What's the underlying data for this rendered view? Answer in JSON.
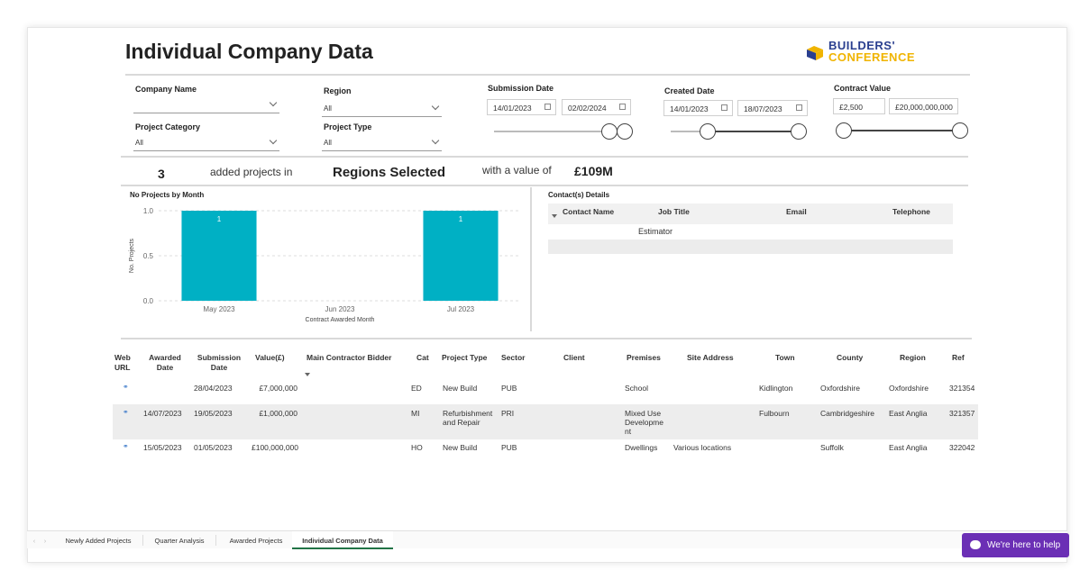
{
  "header": {
    "title": "Individual Company Data",
    "logo_line1": "BUILDERS'",
    "logo_line2": "CONFERENCE",
    "logo_icon": "builders-logo-icon",
    "brand_color": "#2a3f8f",
    "accent_color": "#f0b400"
  },
  "filters": {
    "company_name": {
      "label": "Company Name",
      "value": ""
    },
    "region": {
      "label": "Region",
      "value": "All"
    },
    "project_category": {
      "label": "Project Category",
      "value": "All"
    },
    "project_type": {
      "label": "Project Type",
      "value": "All"
    },
    "submission_date": {
      "label": "Submission Date",
      "from": "14/01/2023",
      "to": "02/02/2024"
    },
    "created_date": {
      "label": "Created Date",
      "from": "14/01/2023",
      "to": "18/07/2023"
    },
    "contract_value": {
      "label": "Contract Value",
      "from": "£2,500",
      "to": "£20,000,000,000"
    }
  },
  "kpi": {
    "count": "3",
    "added_text": "added projects in",
    "regions": "Regions Selected",
    "value_text": "with a value of",
    "value": "£109M"
  },
  "chart": {
    "title": "No Projects by Month"
  },
  "chart_data": {
    "type": "bar",
    "categories": [
      "May 2023",
      "Jun 2023",
      "Jul 2023"
    ],
    "values": [
      1,
      0,
      1
    ],
    "xlabel": "Contract Awarded Month",
    "ylabel": "No. Projects",
    "ylim": [
      0,
      1
    ],
    "yticks": [
      "0.0",
      "0.5",
      "1.0"
    ],
    "data_labels": [
      "1",
      "",
      "1"
    ],
    "bar_color": "#00b0c4"
  },
  "contacts": {
    "title": "Contact(s) Details",
    "headers": [
      "Contact Name",
      "Job Title",
      "Email",
      "Telephone"
    ],
    "rows": [
      [
        "",
        "Estimator",
        "",
        ""
      ]
    ]
  },
  "table": {
    "headers": [
      "Web URL",
      "Awarded Date",
      "Submission Date",
      "Value(£)",
      "Main Contractor Bidder",
      "Cat",
      "Project Type",
      "Sector",
      "Client",
      "Premises",
      "Site Address",
      "Town",
      "County",
      "Region",
      "Ref"
    ],
    "rows": [
      [
        "",
        "",
        "28/04/2023",
        "£7,000,000",
        "",
        "ED",
        "New Build",
        "PUB",
        "",
        "School",
        "",
        "Kidlington",
        "Oxfordshire",
        "Oxfordshire",
        "321354"
      ],
      [
        "",
        "14/07/2023",
        "19/05/2023",
        "£1,000,000",
        "",
        "MI",
        "Refurbishment and Repair",
        "PRI",
        "",
        "Mixed Use Development",
        "",
        "Fulbourn",
        "Cambridgeshire",
        "East Anglia",
        "321357"
      ],
      [
        "",
        "15/05/2023",
        "01/05/2023",
        "£100,000,000",
        "",
        "HO",
        "New Build",
        "PUB",
        "",
        "Dwellings",
        "Various locations",
        "",
        "Suffolk",
        "East Anglia",
        "322042"
      ]
    ]
  },
  "tabs": [
    "Newly Added Projects",
    "Quarter Analysis",
    "Awarded Projects",
    "Individual Company Data"
  ],
  "help": {
    "label": "We're here to help",
    "color": "#6b2fb5"
  }
}
